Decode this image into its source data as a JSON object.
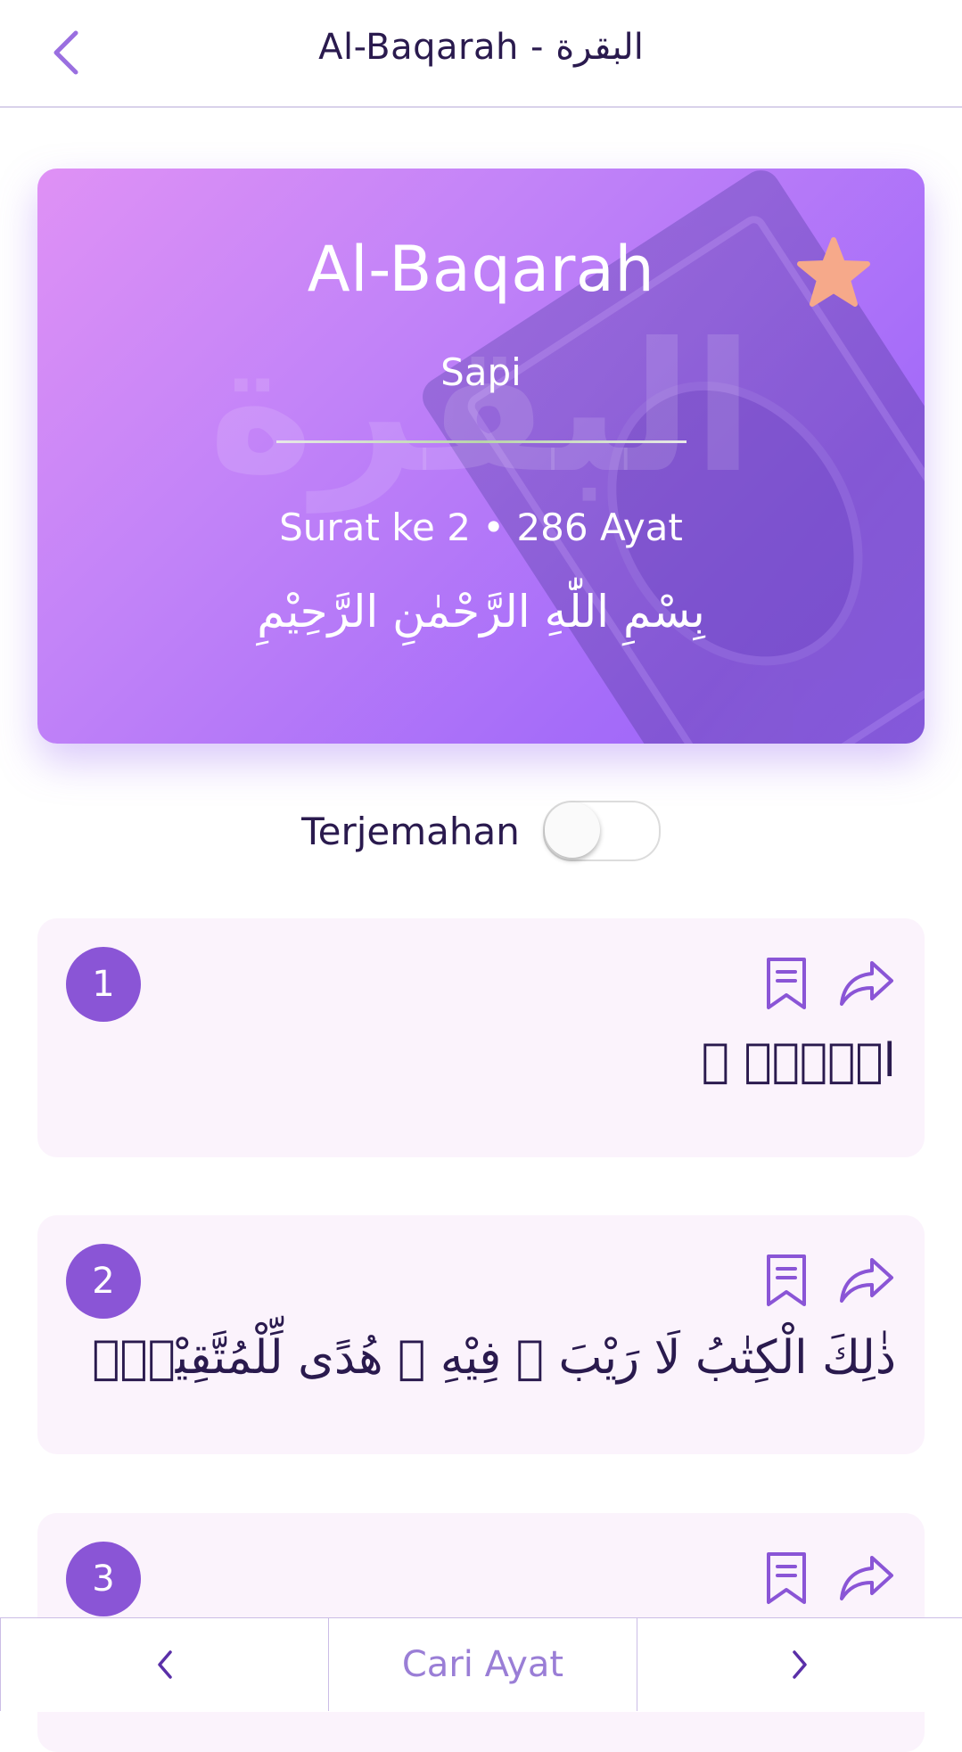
{
  "header": {
    "title": "Al-Baqarah - البقرة"
  },
  "surah_card": {
    "name": "Al-Baqarah",
    "meaning": "Sapi",
    "info": "Surat ke 2 • 286 Ayat",
    "watermark": "البقرة",
    "bismillah": "بِسْمِ اللّٰهِ الرَّحْمٰنِ الرَّحِيْمِ"
  },
  "translation_toggle": {
    "label": "Terjemahan",
    "on": false
  },
  "ayahs": [
    {
      "number": "1",
      "text": "الۤمّۤ ۚ"
    },
    {
      "number": "2",
      "text": "ذٰلِكَ الْكِتٰبُ لَا رَيْبَ ۛ فِيْهِ ۛ هُدًى لِّلْمُتَّقِيْنَۙ"
    },
    {
      "number": "3",
      "text": ""
    }
  ],
  "bottom_nav": {
    "search_label": "Cari Ayat"
  },
  "colors": {
    "accent": "#8a55d6",
    "star": "#f6a98a",
    "ayah_background": "#fbf3fc",
    "card_gradient_start": "#df91f5",
    "card_gradient_end": "#9a62f8"
  }
}
